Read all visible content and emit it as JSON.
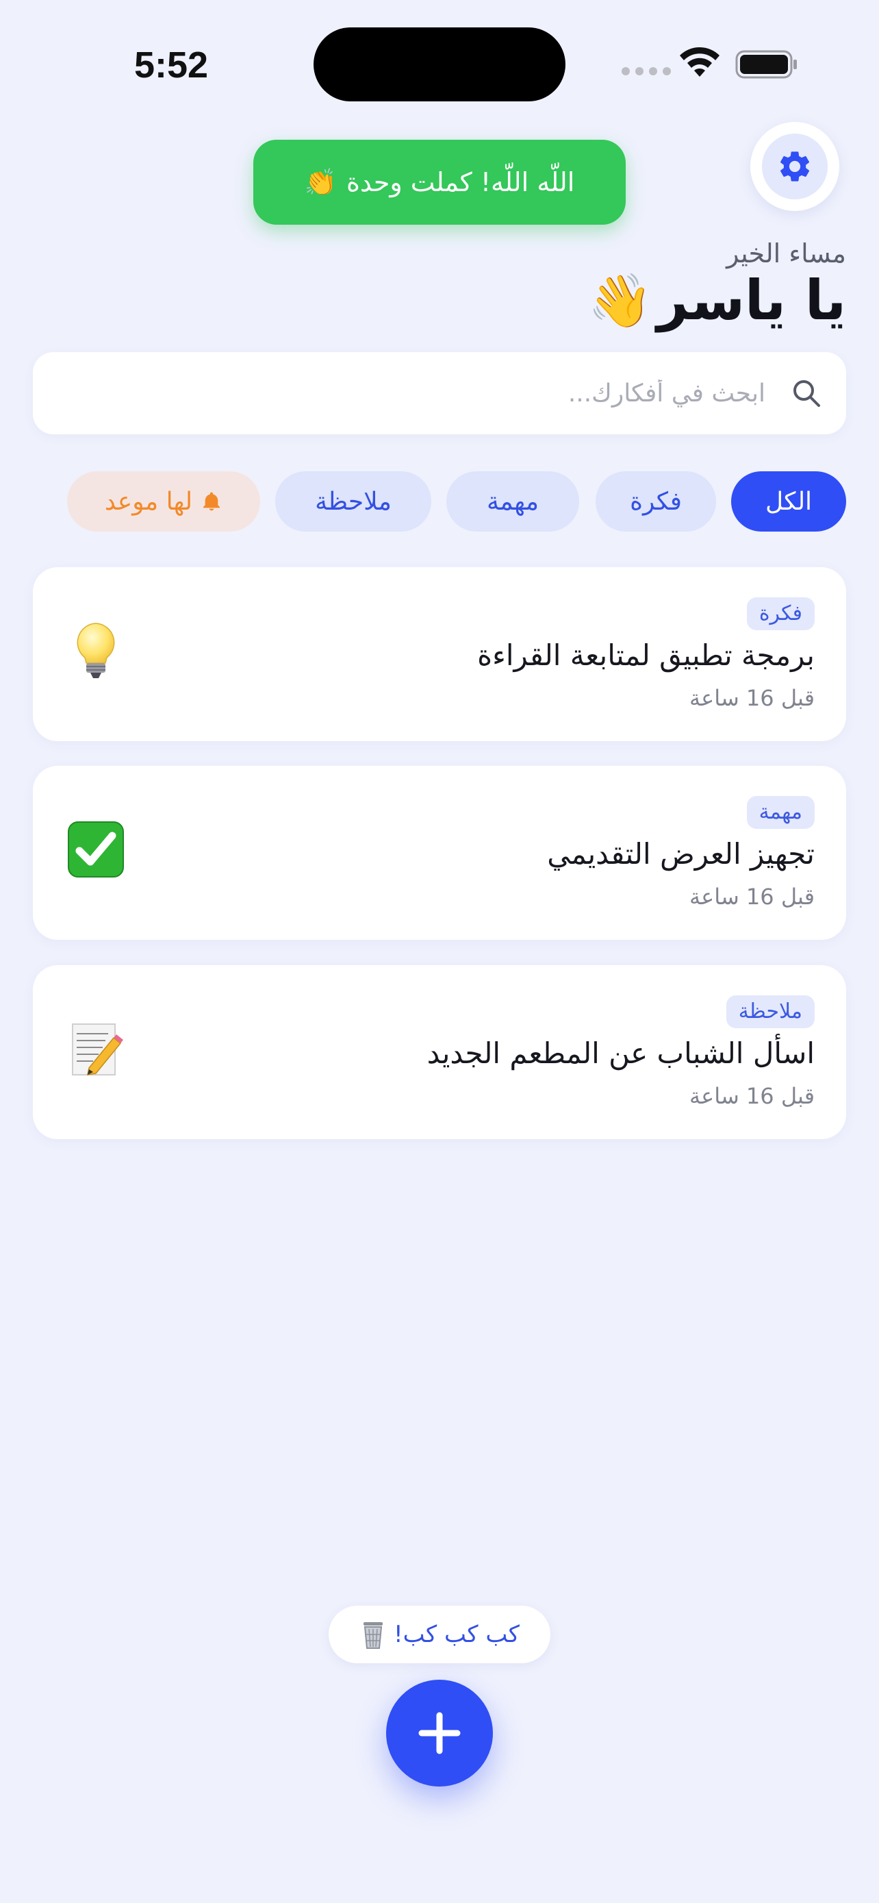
{
  "status_bar": {
    "time": "5:52"
  },
  "toast": {
    "text": "اللّه اللّه! كملت وحدة",
    "emoji": "👏"
  },
  "greeting": {
    "subtitle": "مساء الخير",
    "name": "يا ياسر",
    "emoji": "👋"
  },
  "search": {
    "placeholder": "ابحث في أفكارك...",
    "value": ""
  },
  "filters": [
    {
      "label": "الكل",
      "active": true
    },
    {
      "label": "فكرة",
      "active": false
    },
    {
      "label": "مهمة",
      "active": false
    },
    {
      "label": "ملاحظة",
      "active": false
    },
    {
      "label": "لها موعد",
      "active": false
    }
  ],
  "items": [
    {
      "tag": "فكرة",
      "title": "برمجة تطبيق لمتابعة القراءة",
      "time": "قبل 16 ساعة",
      "icon": "lightbulb-icon"
    },
    {
      "tag": "مهمة",
      "title": "تجهيز العرض التقديمي",
      "time": "قبل 16 ساعة",
      "icon": "checkmark-icon"
    },
    {
      "tag": "ملاحظة",
      "title": "اسأل الشباب عن المطعم الجديد",
      "time": "قبل 16 ساعة",
      "icon": "memo-icon"
    }
  ],
  "undo": {
    "label": "كب كب كب!",
    "icon": "trash-icon"
  },
  "colors": {
    "accent": "#2f4ef5",
    "success": "#34c759",
    "due": "#f28a2a",
    "background": "#eff1fd"
  }
}
